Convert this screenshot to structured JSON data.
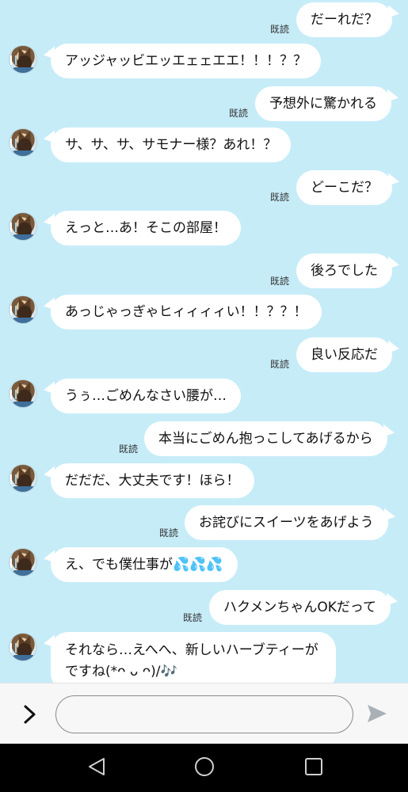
{
  "read_label": "既読",
  "messages": [
    {
      "side": "right",
      "text": "だーれだ？",
      "read": true
    },
    {
      "side": "left",
      "text": "アッジャッビエッエェェエエ！！！？？"
    },
    {
      "side": "right",
      "text": "予想外に驚かれる",
      "read": true
    },
    {
      "side": "left",
      "text": "サ、サ、サ、サモナー様？あれ！？"
    },
    {
      "side": "right",
      "text": "どーこだ？",
      "read": true
    },
    {
      "side": "left",
      "text": "えっと…あ！そこの部屋！"
    },
    {
      "side": "right",
      "text": "後ろでした",
      "read": true
    },
    {
      "side": "left",
      "text": "あっじゃっぎゃヒィィィィい！！？？！"
    },
    {
      "side": "right",
      "text": "良い反応だ",
      "read": true
    },
    {
      "side": "left",
      "text": "うぅ…ごめんなさい腰が…"
    },
    {
      "side": "right",
      "text": "本当にごめん抱っこしてあげるから",
      "read": true
    },
    {
      "side": "left",
      "text": "だだだ、大丈夫です！ほら！"
    },
    {
      "side": "right",
      "text": "お詫びにスイーツをあげよう",
      "read": true
    },
    {
      "side": "left",
      "text": "え、でも僕仕事が💦💦💦"
    },
    {
      "side": "right",
      "text": "ハクメンちゃんOKだって",
      "read": true
    },
    {
      "side": "left",
      "text": "それなら…えへへ、新しいハーブティーがですね(*ᴖ ᴗ ᴖ)/🎶"
    }
  ],
  "input": {
    "value": "",
    "placeholder": ""
  },
  "icons": {
    "expand": "chevron-right-icon",
    "send": "send-icon",
    "nav_back": "nav-back-icon",
    "nav_home": "nav-home-icon",
    "nav_recent": "nav-recent-icon"
  },
  "colors": {
    "background": "#c6ecf8",
    "bubble": "#ffffff",
    "navbar": "#000000"
  }
}
